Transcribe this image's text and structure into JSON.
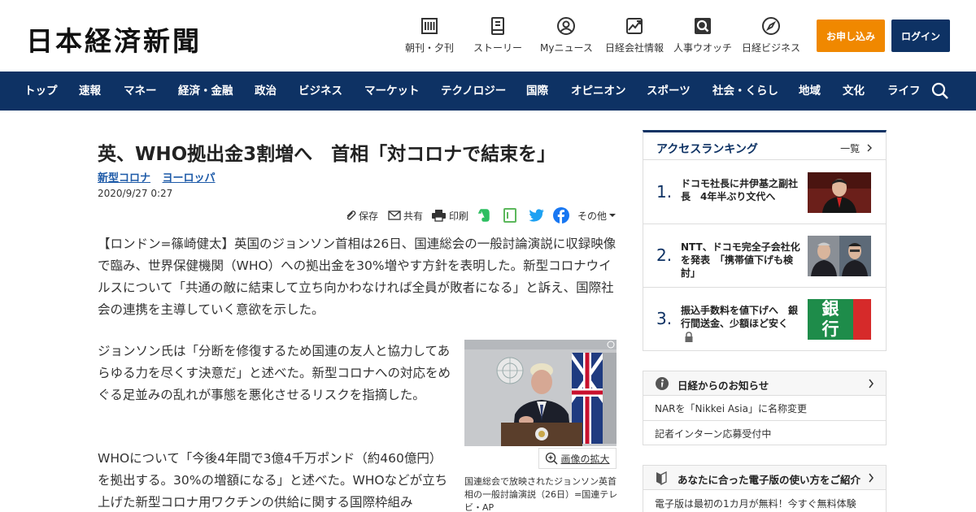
{
  "header": {
    "logo": "日本経済新聞",
    "nav": [
      {
        "label": "朝刊・夕刊",
        "icon": "newspaper-icon"
      },
      {
        "label": "ストーリー",
        "icon": "book-icon"
      },
      {
        "label": "Myニュース",
        "icon": "user-icon"
      },
      {
        "label": "日経会社情報",
        "icon": "stock-chart-icon"
      },
      {
        "label": "人事ウオッチ",
        "icon": "magnifier-icon"
      },
      {
        "label": "日経ビジネス",
        "icon": "compass-icon"
      }
    ],
    "subscribe_label": "お申し込み",
    "login_label": "ログイン"
  },
  "navbar": {
    "items": [
      "トップ",
      "速報",
      "マネー",
      "経済・金融",
      "政治",
      "ビジネス",
      "マーケット",
      "テクノロジー",
      "国際",
      "オピニオン",
      "スポーツ",
      "社会・くらし",
      "地域",
      "文化",
      "ライフ"
    ]
  },
  "article": {
    "title": "英、WHO拠出金3割増へ　首相「対コロナで結束を」",
    "tags": [
      "新型コロナ",
      "ヨーロッパ"
    ],
    "date": "2020/9/27 0:27",
    "share": {
      "save": "保存",
      "share": "共有",
      "print": "印刷",
      "more": "その他"
    },
    "paragraphs": [
      "【ロンドン=篠崎健太】英国のジョンソン首相は26日、国連総会の一般討論演説に収録映像で臨み、世界保健機関（WHO）への拠出金を30%増やす方針を表明した。新型コロナウイルスについて「共通の敵に結束して立ち向かわなければ全員が敗者になる」と訴え、国際社会の連携を主導していく意欲を示した。",
      "ジョンソン氏は「分断を修復するため国連の友人と協力してあらゆる力を尽くす決意だ」と述べた。新型コロナへの対応をめぐる足並みの乱れが事態を悪化させるリスクを指摘した。",
      "WHOについて「今後4年間で3億4千万ポンド（約460億円）を拠出する。30%の増額になる」と述べた。WHOなどが立ち上げた新型コロナ用ワクチンの供給に関する国際枠組み"
    ],
    "photo_enlarge": "画像の拡大",
    "photo_caption": "国連総会で放映されたジョンソン英首相の一般討論演説（26日）=国連テレビ・AP"
  },
  "ranking": {
    "title": "アクセスランキング",
    "more": "一覧",
    "items": [
      {
        "rank": "1.",
        "text": "ドコモ社長に井伊基之副社長　4年半ぶり文代へ"
      },
      {
        "rank": "2.",
        "text": "NTT、ドコモ完全子会社化を発表　「携帯値下げも検討」"
      },
      {
        "rank": "3.",
        "text": "振込手数料を値下げへ　銀行間送金、少額ほど安く"
      }
    ],
    "bank_sign": [
      "銀",
      "行"
    ]
  },
  "notice": {
    "title": "日経からのお知らせ",
    "items": [
      "NARを「Nikkei Asia」に名称変更",
      "記者インターン応募受付中"
    ]
  },
  "guide": {
    "title": "あなたに合った電子版の使い方をご紹介",
    "text": "電子版は最初の1カ月が無料！今すぐ無料体験"
  },
  "colors": {
    "brand_navy": "#0e3264",
    "subscribe_orange": "#f08800",
    "link_blue": "#1d5aa8"
  }
}
